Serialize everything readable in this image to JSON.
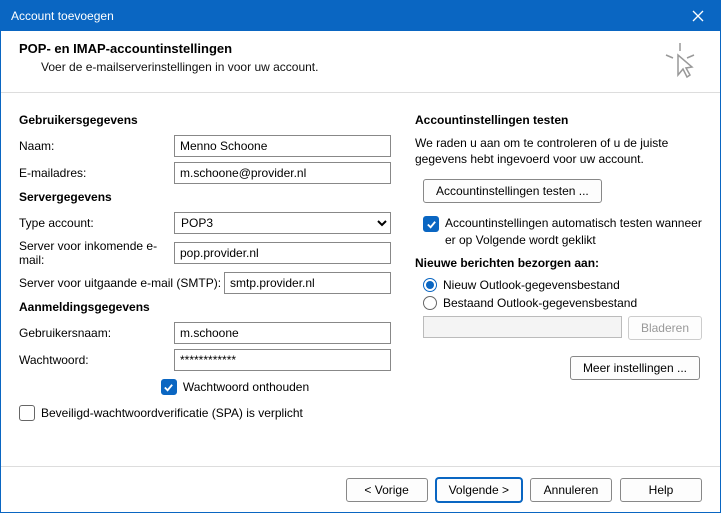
{
  "window": {
    "title": "Account toevoegen"
  },
  "header": {
    "title": "POP- en IMAP-accountinstellingen",
    "subtitle": "Voer de e-mailserverinstellingen in voor uw account."
  },
  "left": {
    "user_section": "Gebruikersgegevens",
    "name_label": "Naam:",
    "name_value": "Menno Schoone",
    "email_label": "E-mailadres:",
    "email_value": "m.schoone@provider.nl",
    "server_section": "Servergegevens",
    "accounttype_label": "Type account:",
    "accounttype_value": "POP3",
    "incoming_label": "Server voor inkomende e-mail:",
    "incoming_value": "pop.provider.nl",
    "outgoing_label": "Server voor uitgaande e-mail (SMTP):",
    "outgoing_value": "smtp.provider.nl",
    "login_section": "Aanmeldingsgegevens",
    "username_label": "Gebruikersnaam:",
    "username_value": "m.schoone",
    "password_label": "Wachtwoord:",
    "password_value": "************",
    "remember_password": "Wachtwoord onthouden",
    "spa_label": "Beveiligd-wachtwoordverificatie (SPA) is verplicht"
  },
  "right": {
    "test_section": "Accountinstellingen testen",
    "test_desc": "We raden u aan om te controleren of u de juiste gegevens hebt ingevoerd voor uw account.",
    "test_button": "Accountinstellingen testen ...",
    "auto_test_label": "Accountinstellingen automatisch testen wanneer er op Volgende wordt geklikt",
    "deliver_section": "Nieuwe berichten bezorgen aan:",
    "deliver_new": "Nieuw Outlook-gegevensbestand",
    "deliver_existing": "Bestaand Outlook-gegevensbestand",
    "browse_button": "Bladeren",
    "more_settings": "Meer instellingen ..."
  },
  "footer": {
    "back": "< Vorige",
    "next": "Volgende >",
    "cancel": "Annuleren",
    "help": "Help"
  }
}
